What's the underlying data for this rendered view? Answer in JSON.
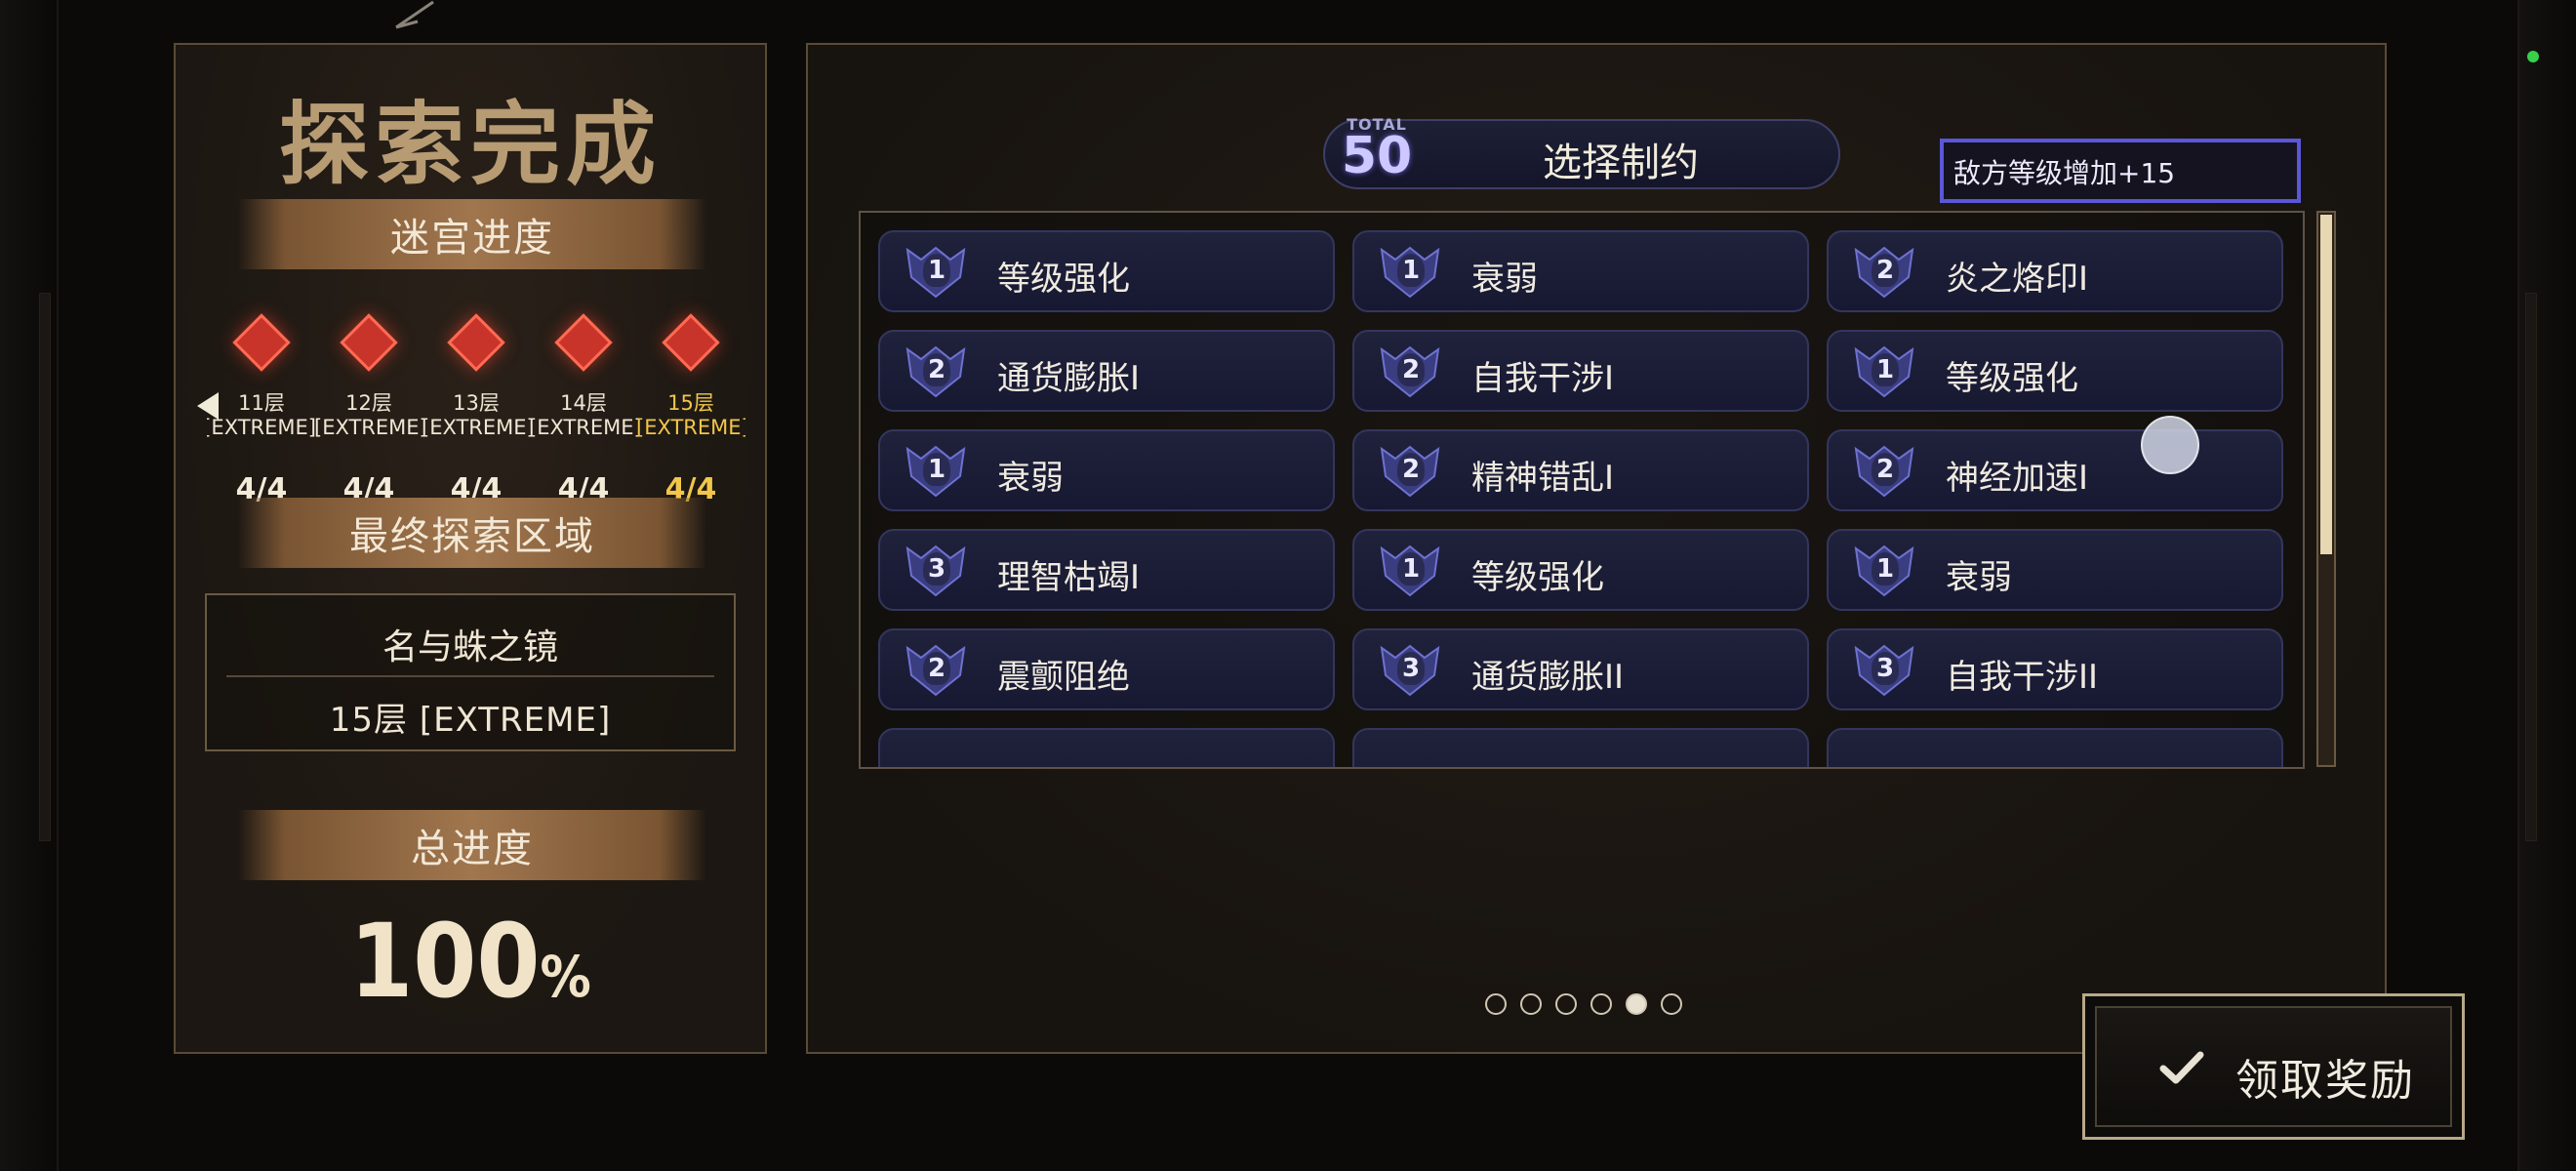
{
  "left_panel": {
    "title": "探索完成",
    "maze_progress_label": "迷宫进度",
    "floors": [
      {
        "name": "11层",
        "difficulty": "[EXTREME]",
        "progress": "4/4",
        "active": false
      },
      {
        "name": "12层",
        "difficulty": "[EXTREME]",
        "progress": "4/4",
        "active": false
      },
      {
        "name": "13层",
        "difficulty": "[EXTREME]",
        "progress": "4/4",
        "active": false
      },
      {
        "name": "14层",
        "difficulty": "[EXTREME]",
        "progress": "4/4",
        "active": false
      },
      {
        "name": "15层",
        "difficulty": "[EXTREME]",
        "progress": "4/4",
        "active": true
      }
    ],
    "final_area_label": "最终探索区域",
    "final_area": {
      "zone": "名与蛛之镜",
      "floor": "15层 [EXTREME]"
    },
    "total_progress_label": "总进度",
    "total_progress": {
      "value": "100",
      "unit": "%"
    }
  },
  "right_panel": {
    "total_label": "TOTAL",
    "total_value": "50",
    "header_title": "选择制约",
    "enemy_level_text": "敌方等级增加+15",
    "constraints": [
      {
        "level": "1",
        "name": "等级强化"
      },
      {
        "level": "1",
        "name": "衰弱"
      },
      {
        "level": "2",
        "name": "炎之烙印I"
      },
      {
        "level": "2",
        "name": "通货膨胀I"
      },
      {
        "level": "2",
        "name": "自我干涉I"
      },
      {
        "level": "1",
        "name": "等级强化"
      },
      {
        "level": "1",
        "name": "衰弱"
      },
      {
        "level": "2",
        "name": "精神错乱I"
      },
      {
        "level": "2",
        "name": "神经加速I"
      },
      {
        "level": "3",
        "name": "理智枯竭I"
      },
      {
        "level": "1",
        "name": "等级强化"
      },
      {
        "level": "1",
        "name": "衰弱"
      },
      {
        "level": "2",
        "name": "震颤阻绝"
      },
      {
        "level": "3",
        "name": "通货膨胀II"
      },
      {
        "level": "3",
        "name": "自我干涉II"
      }
    ],
    "page_count": 6,
    "active_page": 5
  },
  "claim_button": {
    "label": "领取奖励",
    "icon": "check-icon"
  },
  "colors": {
    "accent_purple": "#5a57d8",
    "floor_diamond": "#c8342a",
    "active_floor": "#f2c64a",
    "banner": "#a0764e"
  }
}
